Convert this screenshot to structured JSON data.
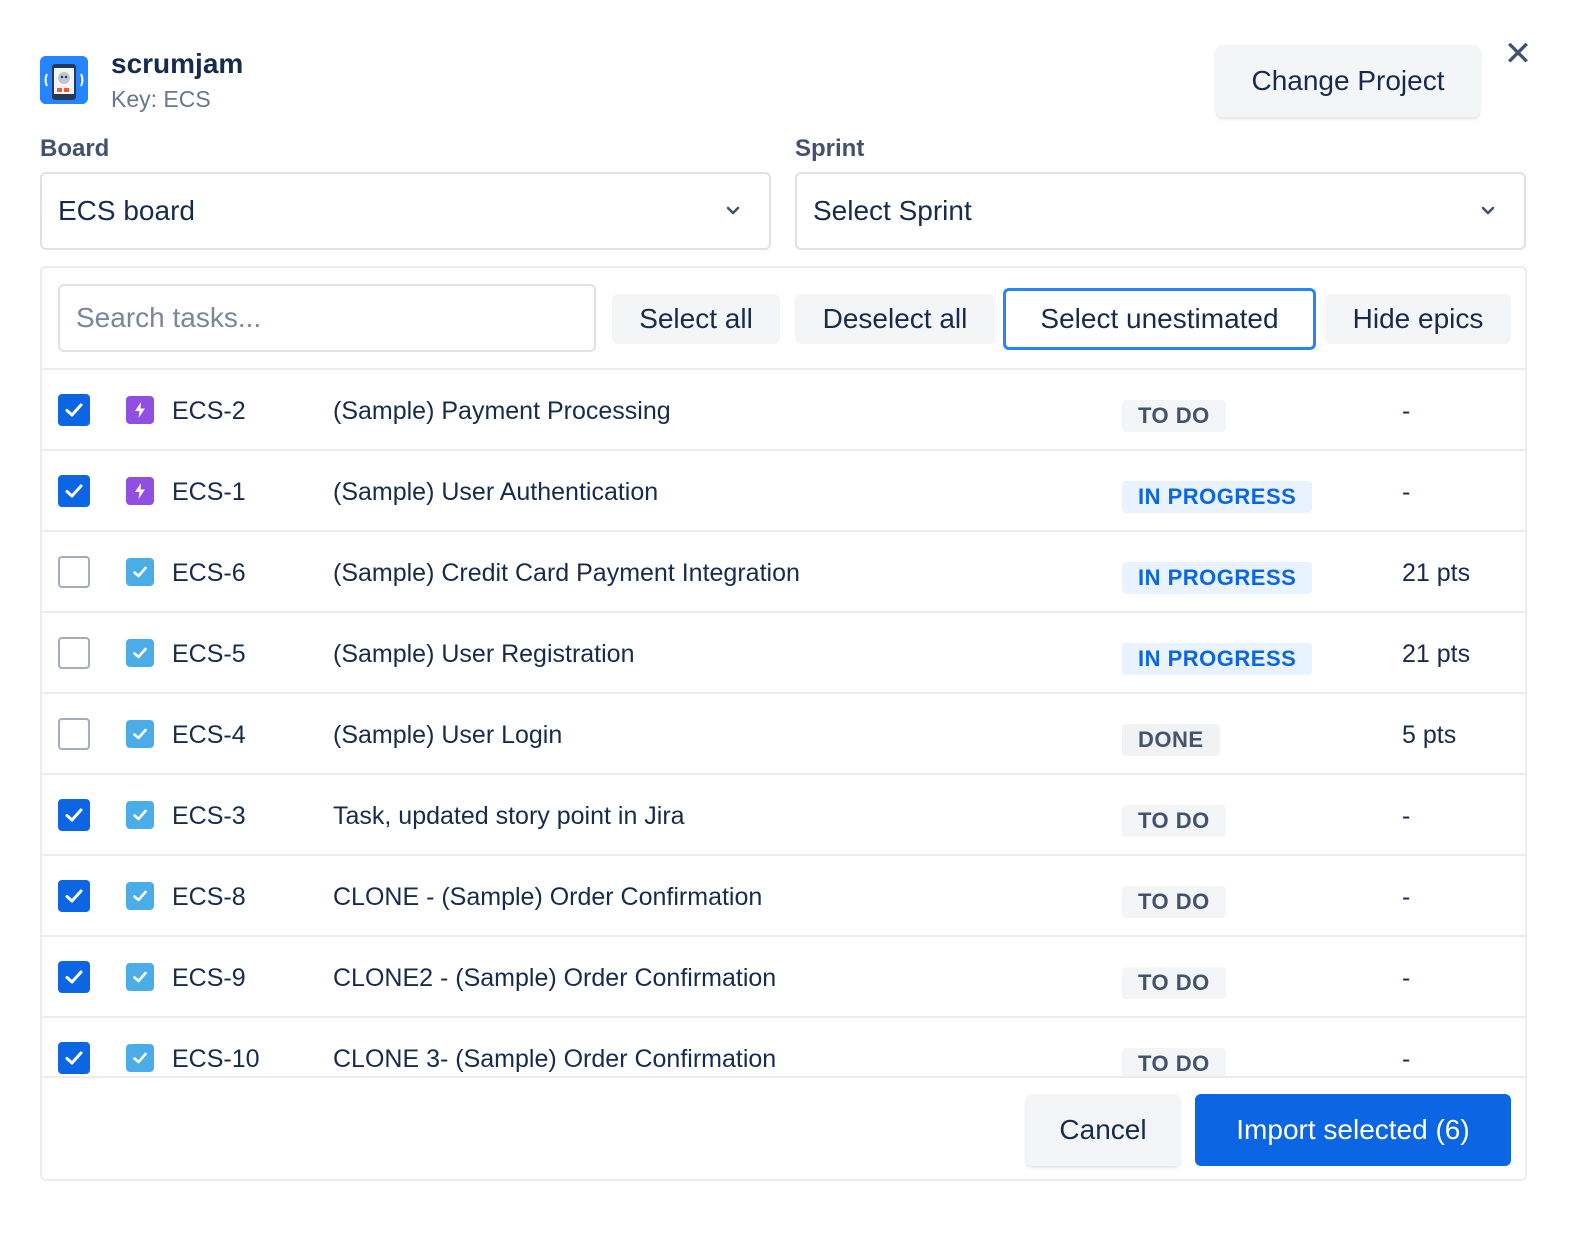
{
  "project": {
    "name": "scrumjam",
    "key_label": "Key: ECS",
    "change_label": "Change Project"
  },
  "board": {
    "label": "Board",
    "value": "ECS board"
  },
  "sprint": {
    "label": "Sprint",
    "value": "Select Sprint"
  },
  "toolbar": {
    "search_placeholder": "Search tasks...",
    "select_all": "Select all",
    "deselect_all": "Deselect all",
    "select_unestimated": "Select unestimated",
    "hide_epics": "Hide epics"
  },
  "tasks": [
    {
      "checked": true,
      "type": "epic",
      "key": "ECS-2",
      "summary": "(Sample) Payment Processing",
      "status": "TO DO",
      "status_kind": "todo",
      "points": "-"
    },
    {
      "checked": true,
      "type": "epic",
      "key": "ECS-1",
      "summary": "(Sample) User Authentication",
      "status": "IN PROGRESS",
      "status_kind": "inprogress",
      "points": "-"
    },
    {
      "checked": false,
      "type": "task",
      "key": "ECS-6",
      "summary": "(Sample) Credit Card Payment Integration",
      "status": "IN PROGRESS",
      "status_kind": "inprogress",
      "points": "21 pts"
    },
    {
      "checked": false,
      "type": "task",
      "key": "ECS-5",
      "summary": "(Sample) User Registration",
      "status": "IN PROGRESS",
      "status_kind": "inprogress",
      "points": "21 pts"
    },
    {
      "checked": false,
      "type": "task",
      "key": "ECS-4",
      "summary": "(Sample) User Login",
      "status": "DONE",
      "status_kind": "done",
      "points": "5 pts"
    },
    {
      "checked": true,
      "type": "task",
      "key": "ECS-3",
      "summary": "Task, updated story point in Jira",
      "status": "TO DO",
      "status_kind": "todo",
      "points": "-"
    },
    {
      "checked": true,
      "type": "task",
      "key": "ECS-8",
      "summary": "CLONE - (Sample) Order Confirmation",
      "status": "TO DO",
      "status_kind": "todo",
      "points": "-"
    },
    {
      "checked": true,
      "type": "task",
      "key": "ECS-9",
      "summary": "CLONE2 - (Sample) Order Confirmation",
      "status": "TO DO",
      "status_kind": "todo",
      "points": "-"
    },
    {
      "checked": true,
      "type": "task",
      "key": "ECS-10",
      "summary": "CLONE 3- (Sample) Order Confirmation",
      "status": "TO DO",
      "status_kind": "todo",
      "points": "-"
    }
  ],
  "footer": {
    "cancel": "Cancel",
    "import": "Import selected (6)"
  },
  "colors": {
    "primary": "#0c66e4",
    "focus": "#2684ff",
    "epic": "#904ee2",
    "task": "#4bade8"
  },
  "icons": {
    "close": "close-icon",
    "dropdown": "chevron-down-icon",
    "epic": "epic-lightning-icon",
    "task": "task-check-icon",
    "project": "project-avatar-icon"
  }
}
